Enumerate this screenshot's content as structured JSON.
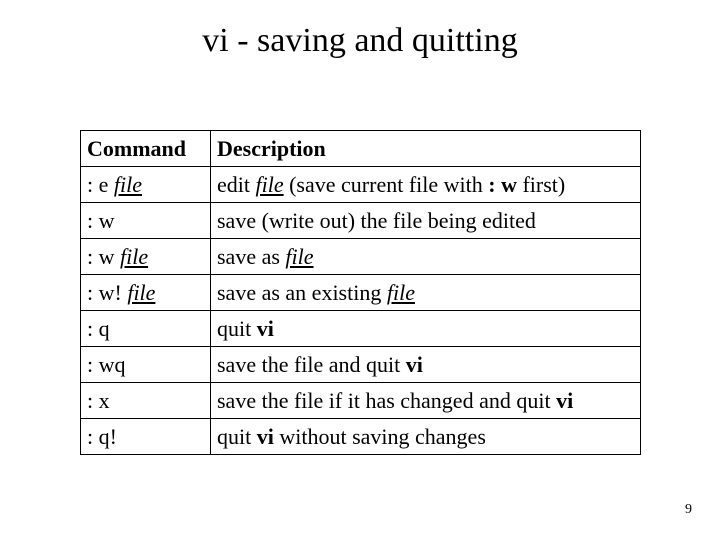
{
  "title": "vi - saving and quitting",
  "page_number": "9",
  "headers": {
    "cmd": "Command",
    "desc": "Description"
  },
  "rows": [
    {
      "cmd_pre": ": e ",
      "cmd_file": "file",
      "cmd_post": "",
      "desc_pre": "edit ",
      "desc_file": "file",
      "desc_mid": " (save current file with ",
      "desc_bold": ": w",
      "desc_post": " first)"
    },
    {
      "cmd_pre": ": w",
      "cmd_file": "",
      "cmd_post": "",
      "desc_pre": "save (write out) the file being edited",
      "desc_file": "",
      "desc_mid": "",
      "desc_bold": "",
      "desc_post": ""
    },
    {
      "cmd_pre": ": w ",
      "cmd_file": "file",
      "cmd_post": "",
      "desc_pre": "save as ",
      "desc_file": "file",
      "desc_mid": "",
      "desc_bold": "",
      "desc_post": ""
    },
    {
      "cmd_pre": ": w! ",
      "cmd_file": "file",
      "cmd_post": "",
      "desc_pre": "save as an existing ",
      "desc_file": "file",
      "desc_mid": "",
      "desc_bold": "",
      "desc_post": ""
    },
    {
      "cmd_pre": ": q",
      "cmd_file": "",
      "cmd_post": "",
      "desc_pre": "quit ",
      "desc_file": "",
      "desc_mid": "",
      "desc_bold": "vi",
      "desc_post": ""
    },
    {
      "cmd_pre": ": wq",
      "cmd_file": "",
      "cmd_post": "",
      "desc_pre": "save the file and quit ",
      "desc_file": "",
      "desc_mid": "",
      "desc_bold": "vi",
      "desc_post": ""
    },
    {
      "cmd_pre": ": x",
      "cmd_file": "",
      "cmd_post": "",
      "desc_pre": "save the file if it has changed and quit ",
      "desc_file": "",
      "desc_mid": "",
      "desc_bold": "vi",
      "desc_post": ""
    },
    {
      "cmd_pre": ": q!",
      "cmd_file": "",
      "cmd_post": "",
      "desc_pre": "quit ",
      "desc_file": "",
      "desc_mid": "",
      "desc_bold": "vi",
      "desc_post": " without saving changes"
    }
  ]
}
